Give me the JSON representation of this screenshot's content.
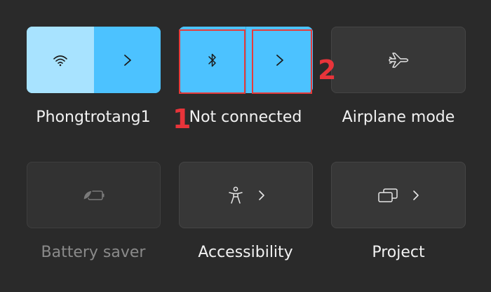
{
  "quick_settings": {
    "wifi": {
      "label": "Phongtrotang1",
      "icon": "wifi-icon",
      "state": "on"
    },
    "bluetooth": {
      "label": "Not connected",
      "icon": "bluetooth-icon",
      "state": "on"
    },
    "airplane": {
      "label": "Airplane mode",
      "icon": "airplane-icon",
      "state": "off"
    },
    "battery_saver": {
      "label": "Battery saver",
      "icon": "battery-saver-icon",
      "state": "disabled"
    },
    "accessibility": {
      "label": "Accessibility",
      "icon": "accessibility-icon"
    },
    "project": {
      "label": "Project",
      "icon": "project-icon"
    }
  },
  "annotations": [
    {
      "number": "1"
    },
    {
      "number": "2"
    }
  ],
  "colors": {
    "accent": "#4cc2ff",
    "accent_light": "#a8e3ff",
    "background": "#2a2a2a",
    "tile_off": "#373737",
    "annotation": "#e63b3b"
  }
}
